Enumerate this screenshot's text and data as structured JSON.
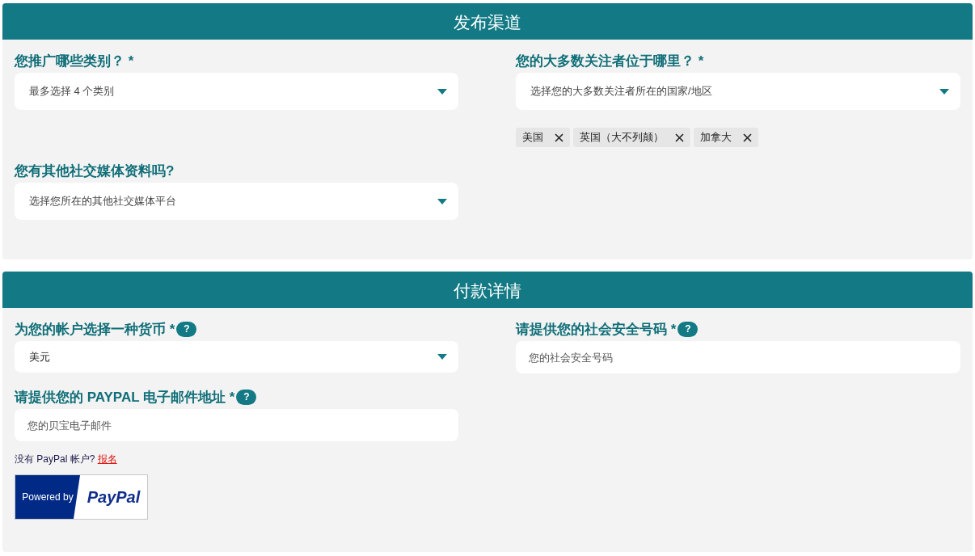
{
  "sections": [
    {
      "title": "发布渠道",
      "rows": [
        [
          {
            "label": "您推广哪些类别？ *",
            "kind": "select",
            "placeholder": "最多选择 4 个类别"
          },
          {
            "label": "您的大多数关注者位于哪里？ *",
            "kind": "select",
            "placeholder": "选择您的大多数关注者所在的国家/地区",
            "chips": [
              "美国",
              "英国（大不列颠）",
              "加拿大"
            ]
          }
        ],
        [
          {
            "label": "您有其他社交媒体资料吗?",
            "kind": "select",
            "placeholder": "选择您所在的其他社交媒体平台"
          }
        ]
      ]
    },
    {
      "title": "付款详情",
      "rows": [
        [
          {
            "label": "为您的帐户选择一种货币 *",
            "help": "?",
            "kind": "select",
            "value": "美元"
          },
          {
            "label": "请提供您的社会安全号码 *",
            "help": "?",
            "kind": "input",
            "placeholder": "您的社会安全号码"
          }
        ],
        [
          {
            "label": "请提供您的 PAYPAL 电子邮件地址 *",
            "help": "?",
            "kind": "input",
            "placeholder": "您的贝宝电子邮件",
            "note": "没有 PayPal 帐户? ",
            "link": "报名",
            "badge": {
              "left": "Powered by",
              "right": "PayPal"
            }
          }
        ]
      ]
    }
  ]
}
